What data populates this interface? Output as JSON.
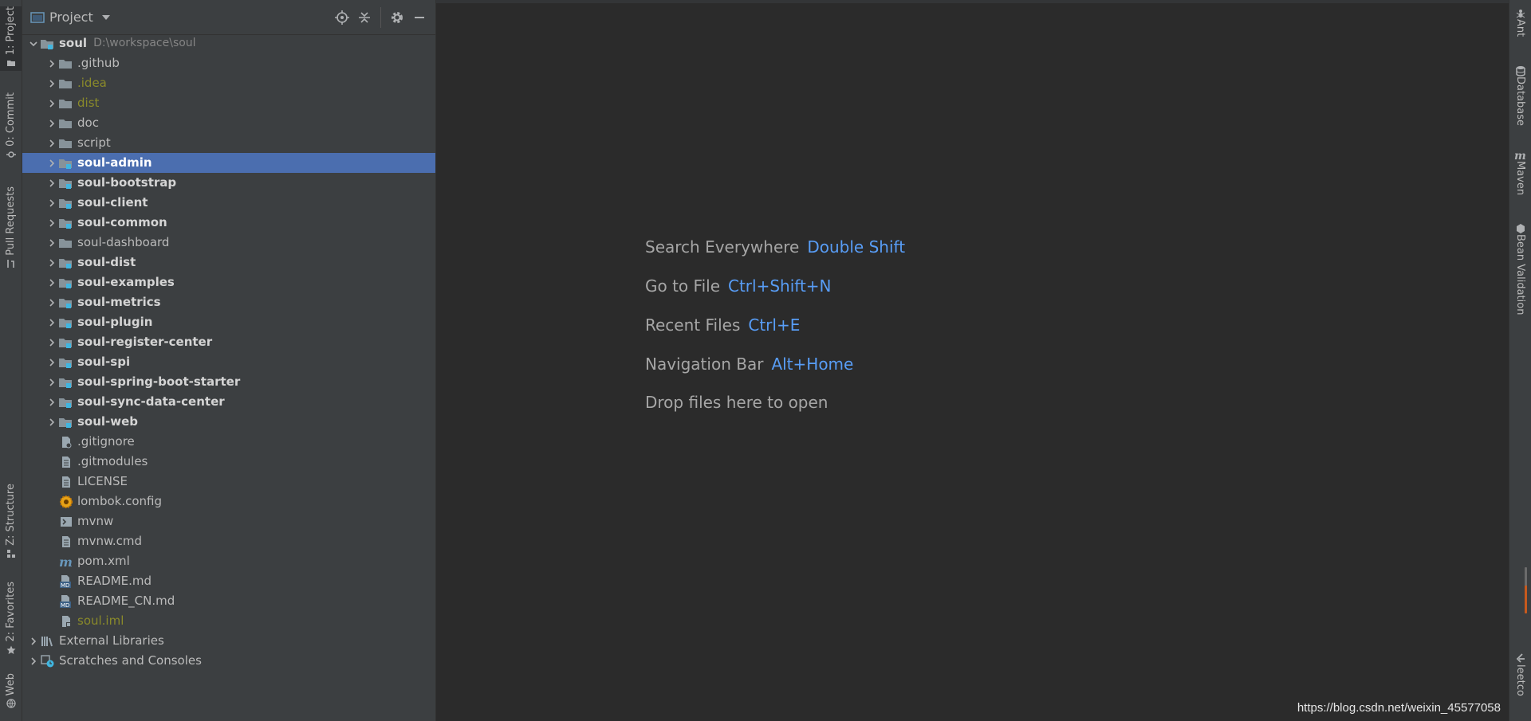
{
  "left_strip": {
    "tabs": [
      {
        "label": "1: Project",
        "icon": "folder-icon",
        "active": true
      },
      {
        "label": "0: Commit",
        "icon": "commit-icon"
      },
      {
        "label": "Pull Requests",
        "icon": "pull-request-icon"
      },
      {
        "label": "Z: Structure",
        "icon": "structure-icon"
      },
      {
        "label": "2: Favorites",
        "icon": "star-icon"
      },
      {
        "label": "Web",
        "icon": "web-icon"
      }
    ]
  },
  "right_strip": {
    "tabs": [
      {
        "label": "Ant",
        "icon": "ant-icon"
      },
      {
        "label": "Database",
        "icon": "database-icon"
      },
      {
        "label": "Maven",
        "icon": "maven-icon"
      },
      {
        "label": "Bean Validation",
        "icon": "bean-validation-icon"
      },
      {
        "label": "leetco",
        "icon": "leetcode-icon"
      }
    ]
  },
  "panel": {
    "title": "Project",
    "icons": [
      "locate-icon",
      "collapse-all-icon",
      "gear-icon",
      "minimize-icon"
    ]
  },
  "tree": {
    "root": {
      "name": "soul",
      "path": "D:\\workspace\\soul"
    },
    "items": [
      {
        "name": ".github",
        "type": "folder",
        "style": "normal"
      },
      {
        "name": ".idea",
        "type": "folder",
        "style": "ignored"
      },
      {
        "name": "dist",
        "type": "folder",
        "style": "ignored"
      },
      {
        "name": "doc",
        "type": "folder",
        "style": "normal"
      },
      {
        "name": "script",
        "type": "folder",
        "style": "normal"
      },
      {
        "name": "soul-admin",
        "type": "module",
        "style": "bold",
        "selected": true
      },
      {
        "name": "soul-bootstrap",
        "type": "module",
        "style": "bold"
      },
      {
        "name": "soul-client",
        "type": "module",
        "style": "bold"
      },
      {
        "name": "soul-common",
        "type": "module",
        "style": "bold"
      },
      {
        "name": "soul-dashboard",
        "type": "folder",
        "style": "normal"
      },
      {
        "name": "soul-dist",
        "type": "module",
        "style": "bold"
      },
      {
        "name": "soul-examples",
        "type": "module",
        "style": "bold"
      },
      {
        "name": "soul-metrics",
        "type": "module",
        "style": "bold"
      },
      {
        "name": "soul-plugin",
        "type": "module",
        "style": "bold"
      },
      {
        "name": "soul-register-center",
        "type": "module",
        "style": "bold"
      },
      {
        "name": "soul-spi",
        "type": "module",
        "style": "bold"
      },
      {
        "name": "soul-spring-boot-starter",
        "type": "module",
        "style": "bold"
      },
      {
        "name": "soul-sync-data-center",
        "type": "module",
        "style": "bold"
      },
      {
        "name": "soul-web",
        "type": "module",
        "style": "bold"
      },
      {
        "name": ".gitignore",
        "type": "file",
        "icon": "gitignore-file-icon",
        "style": "normal"
      },
      {
        "name": ".gitmodules",
        "type": "file",
        "icon": "config-file-icon",
        "style": "normal"
      },
      {
        "name": "LICENSE",
        "type": "file",
        "icon": "text-file-icon",
        "style": "normal"
      },
      {
        "name": "lombok.config",
        "type": "file",
        "icon": "lombok-icon",
        "style": "normal"
      },
      {
        "name": "mvnw",
        "type": "file",
        "icon": "shell-script-icon",
        "style": "normal"
      },
      {
        "name": "mvnw.cmd",
        "type": "file",
        "icon": "text-file-icon",
        "style": "normal"
      },
      {
        "name": "pom.xml",
        "type": "file",
        "icon": "maven-file-icon",
        "style": "normal"
      },
      {
        "name": "README.md",
        "type": "file",
        "icon": "markdown-file-icon",
        "style": "normal"
      },
      {
        "name": "README_CN.md",
        "type": "file",
        "icon": "markdown-file-icon",
        "style": "normal"
      },
      {
        "name": "soul.iml",
        "type": "file",
        "icon": "iml-file-icon",
        "style": "ignored"
      }
    ],
    "bottom": [
      {
        "name": "External Libraries",
        "icon": "libraries-icon"
      },
      {
        "name": "Scratches and Consoles",
        "icon": "scratches-icon"
      }
    ]
  },
  "welcome": {
    "hints": [
      {
        "label": "Search Everywhere",
        "key": "Double Shift"
      },
      {
        "label": "Go to File",
        "key": "Ctrl+Shift+N"
      },
      {
        "label": "Recent Files",
        "key": "Ctrl+E"
      },
      {
        "label": "Navigation Bar",
        "key": "Alt+Home"
      },
      {
        "label": "Drop files here to open",
        "key": ""
      }
    ]
  },
  "watermark": "https://blog.csdn.net/weixin_45577058",
  "colors": {
    "selection": "#4b6eaf",
    "shortcut": "#589df6",
    "ignored_file": "#8a8a2a",
    "panel_bg": "#3c3f41",
    "editor_bg": "#2b2b2b"
  }
}
